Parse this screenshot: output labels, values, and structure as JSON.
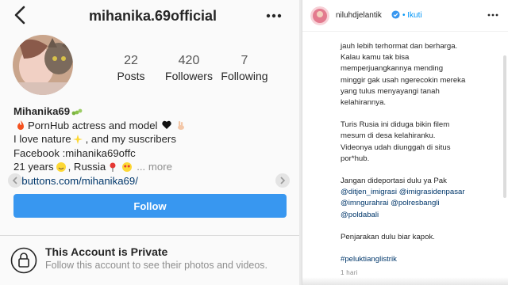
{
  "profile": {
    "username": "mihanika.69official",
    "stats": {
      "posts": {
        "count": "22",
        "label": "Posts"
      },
      "followers": {
        "count": "420",
        "label": "Followers"
      },
      "following": {
        "count": "7",
        "label": "Following"
      }
    },
    "bio": {
      "name": "Mihanika69",
      "line1": "PornHub actress and model",
      "line2a": "I love nature",
      "line2b": ", and my suscribers",
      "line3": "Facebook :mihanika69offc",
      "line4a": "21 years",
      "line4b": ", Russia",
      "more": "... more",
      "link": "l1buttons.com/mihanika69/"
    },
    "follow_button": "Follow",
    "private": {
      "title": "This Account is Private",
      "subtitle": "Follow this account to see their photos and videos."
    }
  },
  "post": {
    "user": "niluhdjelantik",
    "follow": "• Ikuti",
    "caption": {
      "p1": [
        "jauh lebih terhormat dan berharga.",
        "Kalau kamu tak bisa",
        "memperjuangkannya mending",
        "minggir gak usah ngerecokin mereka",
        "yang tulus menyayangi tanah",
        "kelahirannya."
      ],
      "p2": [
        "Turis Rusia ini diduga bikin filem",
        "mesum di desa kelahiranku.",
        "Videonya udah diunggah di situs",
        "por*hub."
      ],
      "p3_intro": "Jangan dideportasi dulu ya Pak",
      "tags": [
        "@ditjen_imigrasi",
        "@imigrasidenpasar",
        "@imngurahrai",
        "@polresbangli",
        "@poldabali"
      ],
      "p4": "Penjarakan dulu biar kapok.",
      "hashtag": "#peluktianglistrik"
    },
    "time": "1 hari"
  },
  "colors": {
    "follow_button": "#3897f0",
    "link": "#00376b",
    "ig_blue": "#0095f6",
    "muted": "#8e8e8e"
  },
  "icons": [
    "back-arrow-icon",
    "more-dots-icon",
    "lock-icon",
    "verified-badge-icon",
    "fire-icon",
    "heart-icon",
    "hand-icon",
    "sparkles-icon",
    "smile-icon",
    "pin-icon",
    "heart-eyes-icon",
    "caterpillar-icon"
  ]
}
